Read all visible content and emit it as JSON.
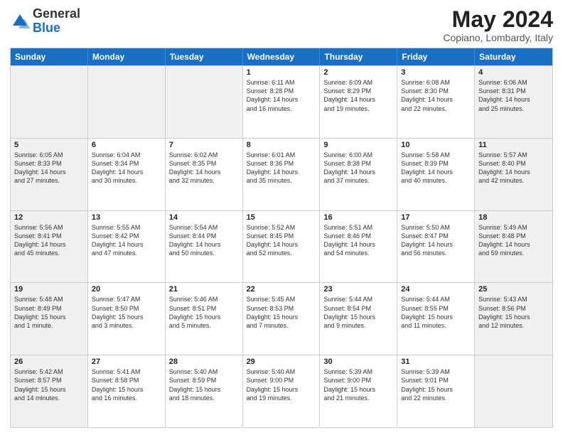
{
  "header": {
    "logo_general": "General",
    "logo_blue": "Blue",
    "month_title": "May 2024",
    "location": "Copiano, Lombardy, Italy"
  },
  "weekdays": [
    "Sunday",
    "Monday",
    "Tuesday",
    "Wednesday",
    "Thursday",
    "Friday",
    "Saturday"
  ],
  "rows": [
    [
      {
        "day": "",
        "text": "",
        "shaded": true
      },
      {
        "day": "",
        "text": "",
        "shaded": true
      },
      {
        "day": "",
        "text": "",
        "shaded": true
      },
      {
        "day": "1",
        "text": "Sunrise: 6:11 AM\nSunset: 8:28 PM\nDaylight: 14 hours\nand 16 minutes.",
        "shaded": false
      },
      {
        "day": "2",
        "text": "Sunrise: 6:09 AM\nSunset: 8:29 PM\nDaylight: 14 hours\nand 19 minutes.",
        "shaded": false
      },
      {
        "day": "3",
        "text": "Sunrise: 6:08 AM\nSunset: 8:30 PM\nDaylight: 14 hours\nand 22 minutes.",
        "shaded": false
      },
      {
        "day": "4",
        "text": "Sunrise: 6:06 AM\nSunset: 8:31 PM\nDaylight: 14 hours\nand 25 minutes.",
        "shaded": true
      }
    ],
    [
      {
        "day": "5",
        "text": "Sunrise: 6:05 AM\nSunset: 8:33 PM\nDaylight: 14 hours\nand 27 minutes.",
        "shaded": true
      },
      {
        "day": "6",
        "text": "Sunrise: 6:04 AM\nSunset: 8:34 PM\nDaylight: 14 hours\nand 30 minutes.",
        "shaded": false
      },
      {
        "day": "7",
        "text": "Sunrise: 6:02 AM\nSunset: 8:35 PM\nDaylight: 14 hours\nand 32 minutes.",
        "shaded": false
      },
      {
        "day": "8",
        "text": "Sunrise: 6:01 AM\nSunset: 8:36 PM\nDaylight: 14 hours\nand 35 minutes.",
        "shaded": false
      },
      {
        "day": "9",
        "text": "Sunrise: 6:00 AM\nSunset: 8:38 PM\nDaylight: 14 hours\nand 37 minutes.",
        "shaded": false
      },
      {
        "day": "10",
        "text": "Sunrise: 5:58 AM\nSunset: 8:39 PM\nDaylight: 14 hours\nand 40 minutes.",
        "shaded": false
      },
      {
        "day": "11",
        "text": "Sunrise: 5:57 AM\nSunset: 8:40 PM\nDaylight: 14 hours\nand 42 minutes.",
        "shaded": true
      }
    ],
    [
      {
        "day": "12",
        "text": "Sunrise: 5:56 AM\nSunset: 8:41 PM\nDaylight: 14 hours\nand 45 minutes.",
        "shaded": true
      },
      {
        "day": "13",
        "text": "Sunrise: 5:55 AM\nSunset: 8:42 PM\nDaylight: 14 hours\nand 47 minutes.",
        "shaded": false
      },
      {
        "day": "14",
        "text": "Sunrise: 5:54 AM\nSunset: 8:44 PM\nDaylight: 14 hours\nand 50 minutes.",
        "shaded": false
      },
      {
        "day": "15",
        "text": "Sunrise: 5:52 AM\nSunset: 8:45 PM\nDaylight: 14 hours\nand 52 minutes.",
        "shaded": false
      },
      {
        "day": "16",
        "text": "Sunrise: 5:51 AM\nSunset: 8:46 PM\nDaylight: 14 hours\nand 54 minutes.",
        "shaded": false
      },
      {
        "day": "17",
        "text": "Sunrise: 5:50 AM\nSunset: 8:47 PM\nDaylight: 14 hours\nand 56 minutes.",
        "shaded": false
      },
      {
        "day": "18",
        "text": "Sunrise: 5:49 AM\nSunset: 8:48 PM\nDaylight: 14 hours\nand 59 minutes.",
        "shaded": true
      }
    ],
    [
      {
        "day": "19",
        "text": "Sunrise: 5:48 AM\nSunset: 8:49 PM\nDaylight: 15 hours\nand 1 minute.",
        "shaded": true
      },
      {
        "day": "20",
        "text": "Sunrise: 5:47 AM\nSunset: 8:50 PM\nDaylight: 15 hours\nand 3 minutes.",
        "shaded": false
      },
      {
        "day": "21",
        "text": "Sunrise: 5:46 AM\nSunset: 8:51 PM\nDaylight: 15 hours\nand 5 minutes.",
        "shaded": false
      },
      {
        "day": "22",
        "text": "Sunrise: 5:45 AM\nSunset: 8:53 PM\nDaylight: 15 hours\nand 7 minutes.",
        "shaded": false
      },
      {
        "day": "23",
        "text": "Sunrise: 5:44 AM\nSunset: 8:54 PM\nDaylight: 15 hours\nand 9 minutes.",
        "shaded": false
      },
      {
        "day": "24",
        "text": "Sunrise: 5:44 AM\nSunset: 8:55 PM\nDaylight: 15 hours\nand 11 minutes.",
        "shaded": false
      },
      {
        "day": "25",
        "text": "Sunrise: 5:43 AM\nSunset: 8:56 PM\nDaylight: 15 hours\nand 12 minutes.",
        "shaded": true
      }
    ],
    [
      {
        "day": "26",
        "text": "Sunrise: 5:42 AM\nSunset: 8:57 PM\nDaylight: 15 hours\nand 14 minutes.",
        "shaded": true
      },
      {
        "day": "27",
        "text": "Sunrise: 5:41 AM\nSunset: 8:58 PM\nDaylight: 15 hours\nand 16 minutes.",
        "shaded": false
      },
      {
        "day": "28",
        "text": "Sunrise: 5:40 AM\nSunset: 8:59 PM\nDaylight: 15 hours\nand 18 minutes.",
        "shaded": false
      },
      {
        "day": "29",
        "text": "Sunrise: 5:40 AM\nSunset: 9:00 PM\nDaylight: 15 hours\nand 19 minutes.",
        "shaded": false
      },
      {
        "day": "30",
        "text": "Sunrise: 5:39 AM\nSunset: 9:00 PM\nDaylight: 15 hours\nand 21 minutes.",
        "shaded": false
      },
      {
        "day": "31",
        "text": "Sunrise: 5:39 AM\nSunset: 9:01 PM\nDaylight: 15 hours\nand 22 minutes.",
        "shaded": false
      },
      {
        "day": "",
        "text": "",
        "shaded": true
      }
    ]
  ]
}
